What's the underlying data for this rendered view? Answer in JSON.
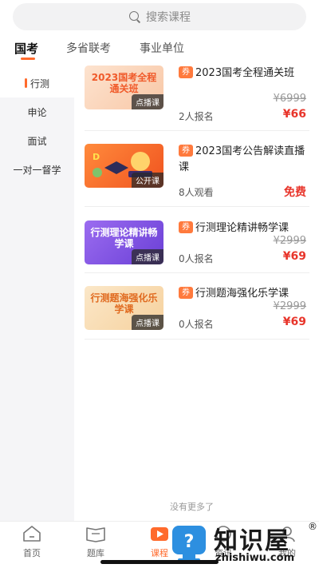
{
  "search": {
    "placeholder": "搜索课程"
  },
  "top_tabs": [
    {
      "label": "国考",
      "active": true
    },
    {
      "label": "多省联考",
      "active": false
    },
    {
      "label": "事业单位",
      "active": false
    }
  ],
  "sidebar": {
    "items": [
      {
        "label": "行测",
        "active": true
      },
      {
        "label": "申论",
        "active": false
      },
      {
        "label": "面试",
        "active": false
      },
      {
        "label": "一对一督学",
        "active": false
      }
    ]
  },
  "courses": [
    {
      "thumb_text": "2023国考全程通关班",
      "thumb_tag": "点播课",
      "coupon": "券",
      "title": "2023国考全程通关班",
      "original_price": "¥6999",
      "count_text": "2人报名",
      "price": "¥66"
    },
    {
      "thumb_text": "",
      "thumb_tag": "公开课",
      "coupon": "券",
      "title": "2023国考公告解读直播课",
      "original_price": "",
      "count_text": "8人观看",
      "price": "免费"
    },
    {
      "thumb_text": "行测理论精讲畅学课",
      "thumb_tag": "点播课",
      "coupon": "券",
      "title": "行测理论精讲畅学课",
      "original_price": "¥2999",
      "count_text": "0人报名",
      "price": "¥69"
    },
    {
      "thumb_text": "行测题海强化乐学课",
      "thumb_tag": "点播课",
      "coupon": "券",
      "title": "行测题海强化乐学课",
      "original_price": "¥2999",
      "count_text": "0人报名",
      "price": "¥69"
    }
  ],
  "list_footer": "没有更多了",
  "bottom_nav": [
    {
      "label": "首页",
      "icon": "home-icon",
      "active": false
    },
    {
      "label": "题库",
      "icon": "book-icon",
      "active": false
    },
    {
      "label": "课程",
      "icon": "play-icon",
      "active": true
    },
    {
      "label": "资讯",
      "icon": "news-icon",
      "active": false
    },
    {
      "label": "我的",
      "icon": "profile-icon",
      "active": false
    }
  ],
  "watermark": {
    "text": "知识屋",
    "url": "zhishiwu.com",
    "reg": "®"
  },
  "colors": {
    "accent": "#ff6a2c",
    "price_red": "#e8352b",
    "sidebar_bg": "#f5f5f7"
  }
}
